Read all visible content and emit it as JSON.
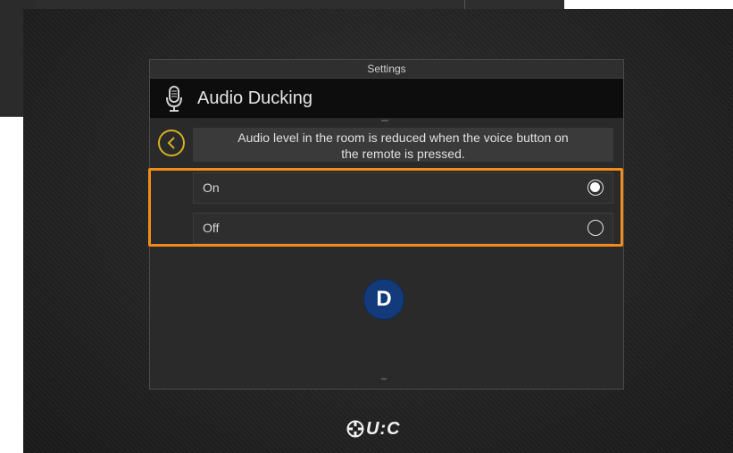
{
  "window": {
    "title": "Settings"
  },
  "header": {
    "title": "Audio Ducking",
    "icon": "microphone-icon"
  },
  "back_button": {
    "icon": "chevron-left-icon"
  },
  "description": {
    "line1": "Audio level in the room is reduced when the voice button on",
    "line2": "the remote is pressed."
  },
  "options": [
    {
      "label": "On",
      "selected": true
    },
    {
      "label": "Off",
      "selected": false
    }
  ],
  "annotation": {
    "badge": "D",
    "highlight_color": "#f08c1a",
    "badge_color": "#133a7a"
  },
  "brand": {
    "logo_text": "U:C"
  },
  "colors": {
    "accent": "#d4b024"
  }
}
